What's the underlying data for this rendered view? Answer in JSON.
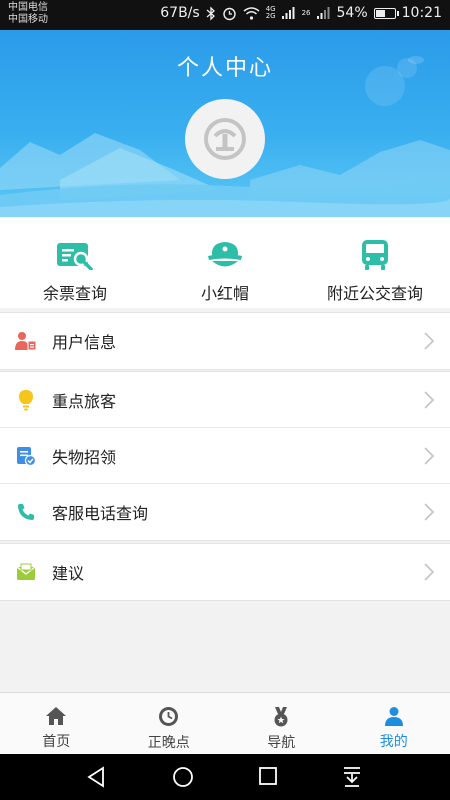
{
  "status_bar": {
    "carrier1": "中国电信",
    "carrier2": "中国移动",
    "speed": "67B/s",
    "net_4g": "4G",
    "net_2g": "2G",
    "net_26": "26",
    "battery": "54%",
    "battery_level": 0.54,
    "time": "10:21"
  },
  "header": {
    "title": "个人中心"
  },
  "shortcuts": [
    {
      "label": "余票查询",
      "icon": "ticket-search-icon"
    },
    {
      "label": "小红帽",
      "icon": "red-cap-icon"
    },
    {
      "label": "附近公交查询",
      "icon": "bus-icon"
    }
  ],
  "menu": {
    "user_info": "用户信息",
    "key_passenger": "重点旅客",
    "lost_found": "失物招领",
    "service_phone": "客服电话查询",
    "suggestion": "建议"
  },
  "tabs": [
    {
      "label": "首页",
      "icon": "home-icon"
    },
    {
      "label": "正晚点",
      "icon": "clock-icon"
    },
    {
      "label": "导航",
      "icon": "medal-icon"
    },
    {
      "label": "我的",
      "icon": "person-icon",
      "active": true
    }
  ],
  "colors": {
    "accent": "#1e8fe0",
    "teal": "#2ebda6",
    "header_top": "#2b9be9"
  }
}
